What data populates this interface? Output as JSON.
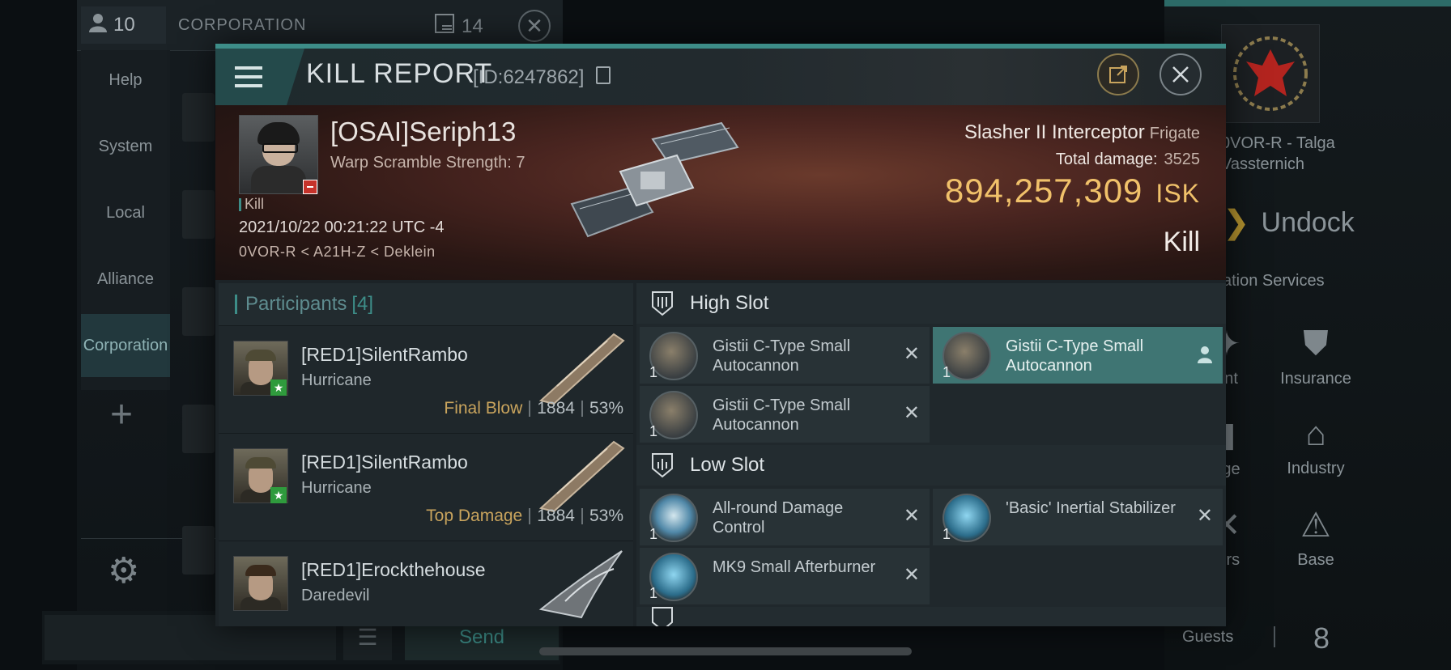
{
  "background": {
    "guest_count": "10",
    "corp_title": "CORPORATION",
    "mail_count": "14",
    "side_items": [
      "Help",
      "System",
      "Local",
      "Alliance",
      "Corporation"
    ],
    "send_label": "Send",
    "emblem_name_line1": "0VOR-R - Talga",
    "emblem_name_line2": "Vassternich",
    "undock_label": "Undock",
    "station_services": "ation Services",
    "services": [
      "ent",
      "Insurance",
      "age",
      "Industry",
      "airs",
      "Base"
    ],
    "guests_label": "Guests",
    "guests_count": "8"
  },
  "header": {
    "title": "KILL REPORT",
    "id_text": "[ID:6247862]"
  },
  "victim": {
    "name": "[OSAI]Seriph13",
    "subtitle": "Warp Scramble Strength: 7",
    "kill_tag": "Kill",
    "datetime": "2021/10/22 00:21:22 UTC -4",
    "location": "0VOR-R < A21H-Z < Deklein",
    "ship_name": "Slasher II Interceptor",
    "ship_class": "Frigate",
    "total_damage_label": "Total damage:",
    "total_damage": "3525",
    "isk_value": "894,257,309",
    "isk_unit": "ISK",
    "result": "Kill"
  },
  "participants": {
    "title": "Participants",
    "count": "[4]",
    "rows": [
      {
        "name": "[RED1]SilentRambo",
        "ship": "Hurricane",
        "tag": "Final Blow",
        "damage": "1884",
        "percent": "53%"
      },
      {
        "name": "[RED1]SilentRambo",
        "ship": "Hurricane",
        "tag": "Top Damage",
        "damage": "1884",
        "percent": "53%"
      },
      {
        "name": "[RED1]Erockthehouse",
        "ship": "Daredevil",
        "tag": "",
        "damage": "",
        "percent": ""
      }
    ]
  },
  "slots": {
    "high_label": "High Slot",
    "low_label": "Low Slot",
    "high_items": [
      {
        "name": "Gistii C-Type Small Autocannon",
        "qty": "1",
        "status": "destroyed"
      },
      {
        "name": "Gistii C-Type Small Autocannon",
        "qty": "1",
        "status": "dropped"
      },
      {
        "name": "Gistii C-Type Small Autocannon",
        "qty": "1",
        "status": "destroyed"
      }
    ],
    "low_items": [
      {
        "name": "All-round Damage Control",
        "qty": "1",
        "status": "destroyed"
      },
      {
        "name": "'Basic' Inertial Stabilizer",
        "qty": "1",
        "status": "destroyed"
      },
      {
        "name": "MK9 Small Afterburner",
        "qty": "1",
        "status": "destroyed"
      }
    ],
    "destroyed_mark": "✕"
  }
}
